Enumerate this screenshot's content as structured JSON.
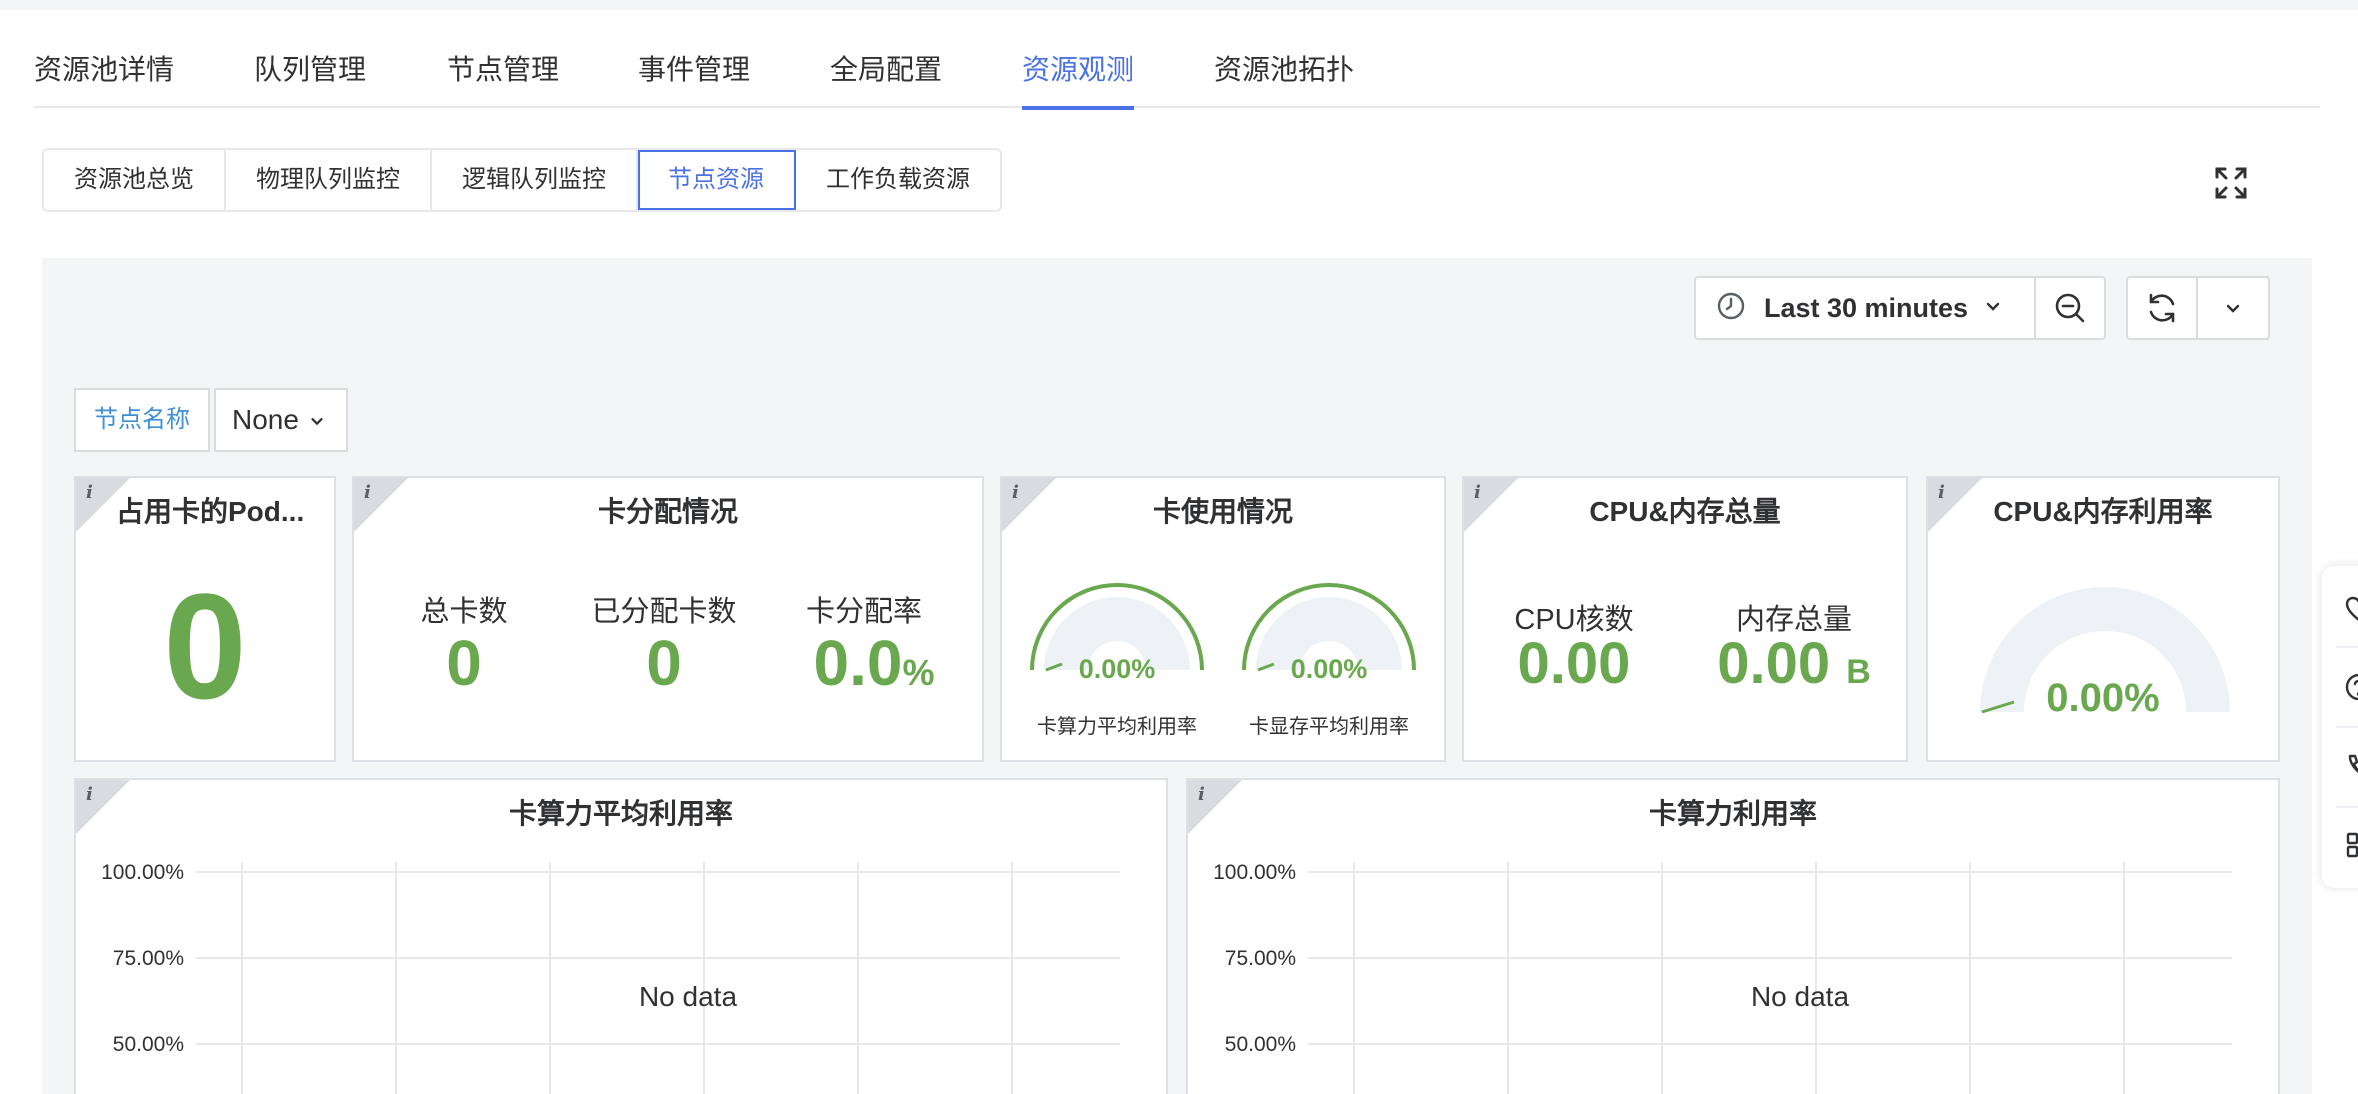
{
  "main_tabs": [
    {
      "label": "资源池详情",
      "active": false
    },
    {
      "label": "队列管理",
      "active": false
    },
    {
      "label": "节点管理",
      "active": false
    },
    {
      "label": "事件管理",
      "active": false
    },
    {
      "label": "全局配置",
      "active": false
    },
    {
      "label": "资源观测",
      "active": true
    },
    {
      "label": "资源池拓扑",
      "active": false
    }
  ],
  "sub_tabs": [
    {
      "label": "资源池总览",
      "active": false
    },
    {
      "label": "物理队列监控",
      "active": false
    },
    {
      "label": "逻辑队列监控",
      "active": false
    },
    {
      "label": "节点资源",
      "active": true
    },
    {
      "label": "工作负载资源",
      "active": false
    }
  ],
  "toolbar": {
    "time_range": "Last 30 minutes"
  },
  "variables": {
    "node_name_label": "节点名称",
    "node_name_value": "None"
  },
  "panels": {
    "pods": {
      "title": "占用卡的Pod...",
      "value": "0"
    },
    "card_alloc": {
      "title": "卡分配情况",
      "total_label": "总卡数",
      "total_value": "0",
      "allocated_label": "已分配卡数",
      "allocated_value": "0",
      "rate_label": "卡分配率",
      "rate_value": "0.0",
      "rate_unit": "%"
    },
    "card_usage": {
      "title": "卡使用情况",
      "compute_value": "0.00%",
      "compute_label": "卡算力平均利用率",
      "memory_value": "0.00%",
      "memory_label": "卡显存平均利用率",
      "compute_fraction": 0.0,
      "memory_fraction": 0.0
    },
    "cpu_mem_total": {
      "title": "CPU&内存总量",
      "cpu_label": "CPU核数",
      "cpu_value": "0.00",
      "mem_label": "内存总量",
      "mem_value": "0.00",
      "mem_unit": "B"
    },
    "cpu_mem_util": {
      "title": "CPU&内存利用率",
      "value": "0.00%",
      "fraction": 0.0
    }
  },
  "chart_data": [
    {
      "type": "line",
      "title": "卡算力平均利用率",
      "y_ticks": [
        "100.00%",
        "75.00%",
        "50.00%"
      ],
      "ylim": [
        0,
        100
      ],
      "series": [],
      "message": "No data",
      "grid": true
    },
    {
      "type": "line",
      "title": "卡算力利用率",
      "y_ticks": [
        "100.00%",
        "75.00%",
        "50.00%"
      ],
      "ylim": [
        0,
        100
      ],
      "series": [],
      "message": "No data",
      "grid": true
    }
  ],
  "colors": {
    "accent": "#4a72e6",
    "value_green": "#6aa84f",
    "variable_label": "#3d8fd6",
    "gauge_track": "#eef2f7"
  },
  "icons": {
    "fullscreen": "expand-icon",
    "time": "clock-icon",
    "zoom_out": "zoom-out-icon",
    "refresh": "refresh-icon",
    "float": [
      "heart-icon",
      "help-icon",
      "phone-icon",
      "grid-icon"
    ]
  }
}
